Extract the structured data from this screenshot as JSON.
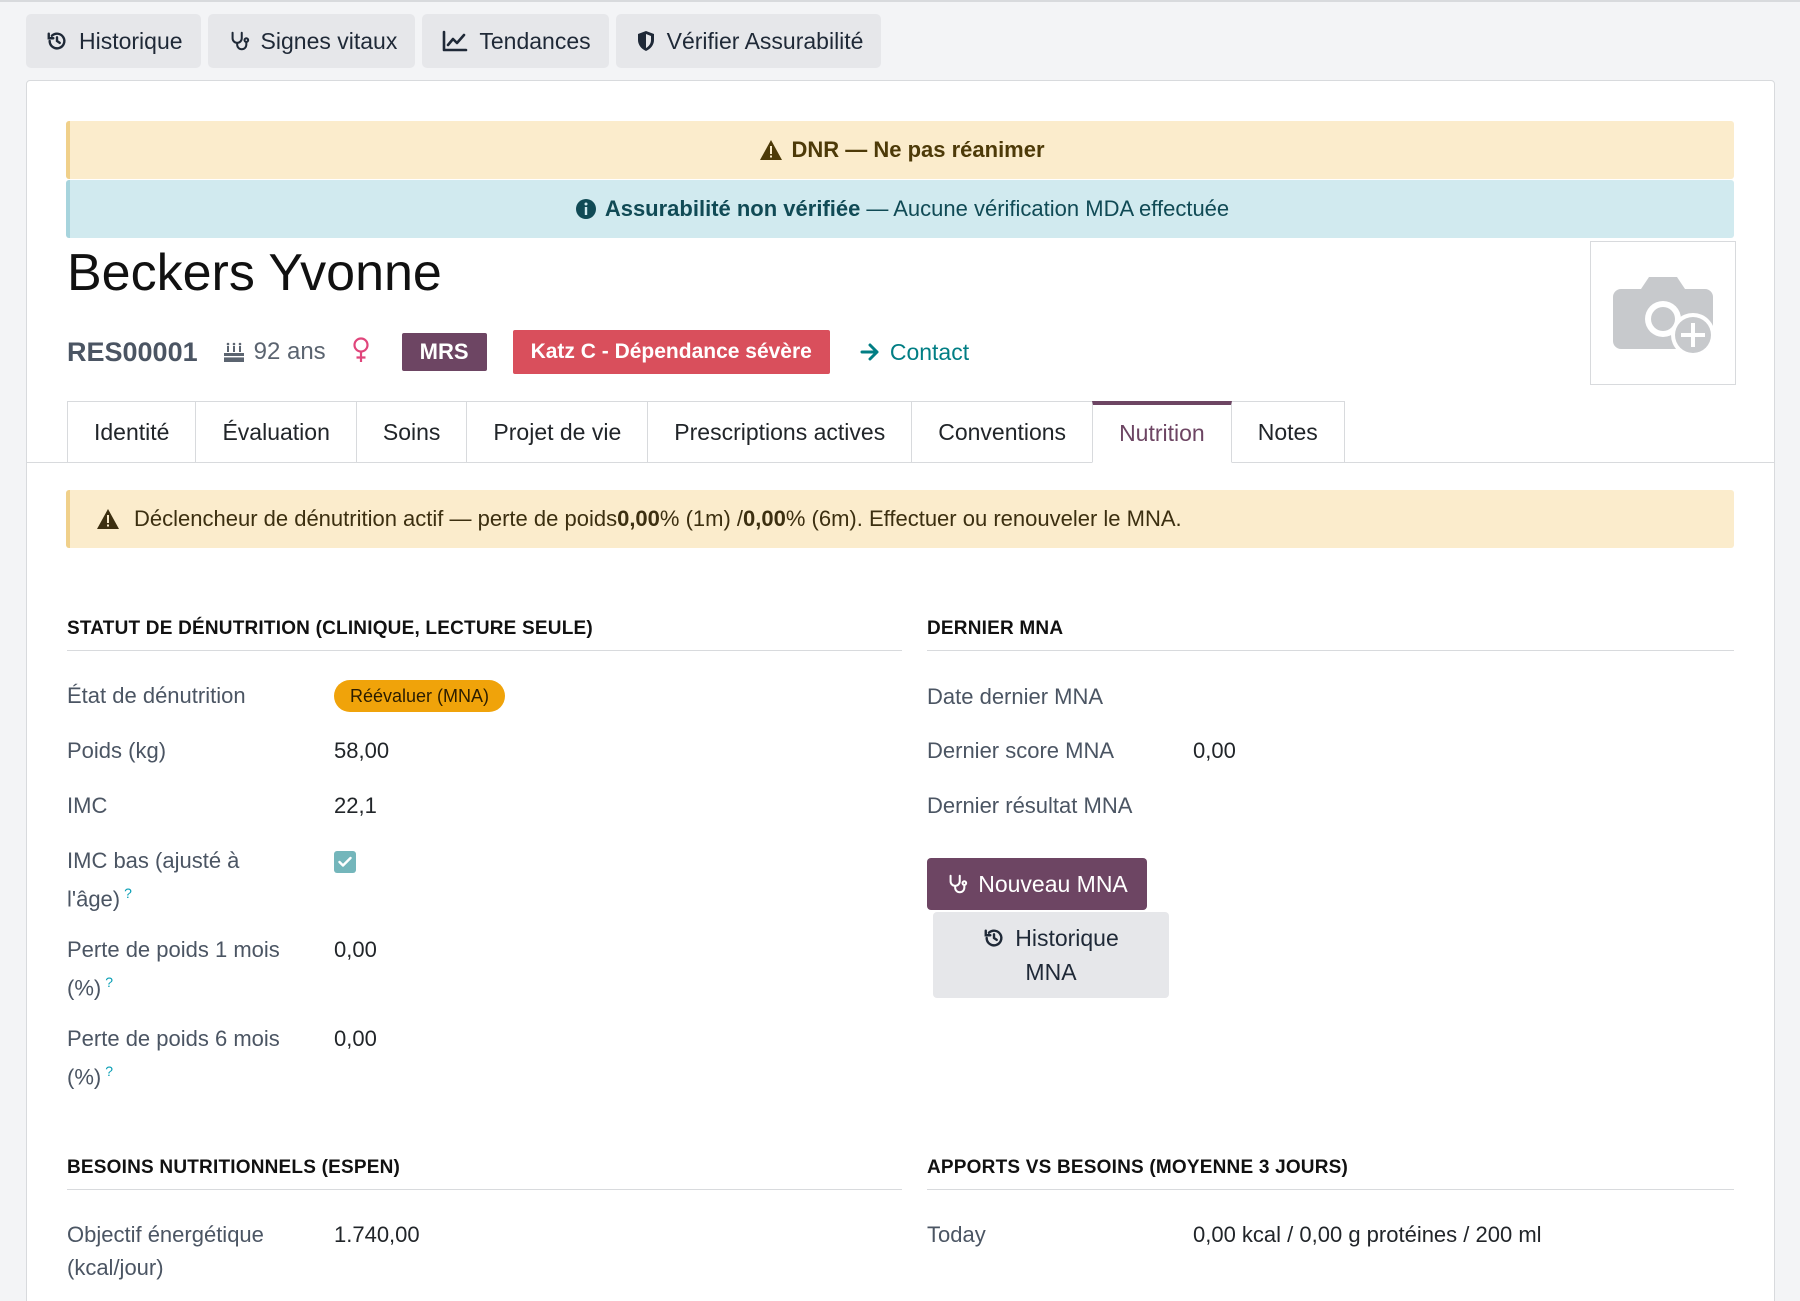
{
  "button_box": {
    "history": "Historique",
    "vitals": "Signes vitaux",
    "trends": "Tendances",
    "verify": "Vérifier Assurabilité"
  },
  "banners": {
    "dnr": "DNR — Ne pas réanimer",
    "assur_strong": "Assurabilité non vérifiée",
    "assur_rest": "— Aucune vérification MDA effectuée"
  },
  "patient": {
    "name": "Beckers Yvonne",
    "ref": "RES00001",
    "age": "92 ans",
    "tag_mrs": "MRS",
    "tag_katz": "Katz C - Dépendance sévère",
    "contact": "Contact"
  },
  "tabs": [
    "Identité",
    "Évaluation",
    "Soins",
    "Projet de vie",
    "Prescriptions actives",
    "Conventions",
    "Nutrition",
    "Notes"
  ],
  "warning": {
    "part1": "Déclencheur de dénutrition actif — perte de poids ",
    "v1": "0,00",
    "part2": "% (1m) / ",
    "v2": "0,00",
    "part3": "% (6m). Effectuer ou renouveler le MNA."
  },
  "denutrition": {
    "title": "STATUT DE DÉNUTRITION (CLINIQUE, LECTURE SEULE)",
    "state_label": "État de dénutrition",
    "state_value": "Réévaluer (MNA)",
    "weight_label": "Poids (kg)",
    "weight_value": "58,00",
    "bmi_label": "IMC",
    "bmi_value": "22,1",
    "low_bmi_label_1": "IMC bas (ajusté à",
    "low_bmi_label_2": "l'âge)",
    "low_bmi_checked": true,
    "loss1_label_1": "Perte de poids 1 mois",
    "loss1_label_2": "(%)",
    "loss1_value": "0,00",
    "loss6_label_1": "Perte de poids 6 mois",
    "loss6_label_2": "(%)",
    "loss6_value": "0,00",
    "help_mark": "?"
  },
  "mna": {
    "title": "DERNIER MNA",
    "date_label": "Date dernier MNA",
    "score_label": "Dernier score MNA",
    "score_value": "0,00",
    "result_label": "Dernier résultat MNA",
    "new_button": "Nouveau MNA",
    "history_button_1": "Historique",
    "history_button_2": "MNA"
  },
  "needs": {
    "title": "BESOINS NUTRITIONNELS (ESPEN)",
    "energy_label_1": "Objectif énergétique",
    "energy_label_2": "(kcal/jour)",
    "energy_value": "1.740,00"
  },
  "intake": {
    "title": "APPORTS VS BESOINS (MOYENNE 3 JOURS)",
    "today_label": "Today",
    "today_value": "0,00 kcal / 0,00 g protéines / 200 ml"
  },
  "colors": {
    "brand": "#6d4563",
    "danger": "#d94f5c",
    "warning_bg": "#fbeccc",
    "info_bg": "#d1eaef",
    "badge_warning": "#f0a30a",
    "link": "#017e84"
  },
  "icons": [
    "history-icon",
    "stethoscope-icon",
    "line-chart-icon",
    "shield-icon",
    "warning-icon",
    "info-icon",
    "camera-plus-icon",
    "birthday-cake-icon",
    "female-icon",
    "arrow-right-icon",
    "check-icon"
  ]
}
